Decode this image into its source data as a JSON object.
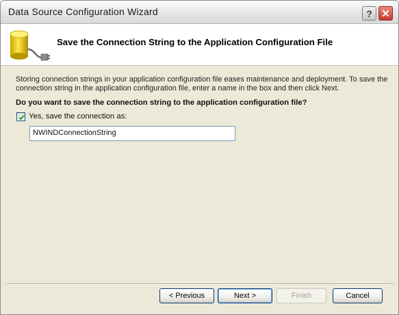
{
  "window": {
    "title": "Data Source Configuration Wizard",
    "help_label": "?",
    "close_label": "✕"
  },
  "header": {
    "title": "Save the Connection String to the Application Configuration File",
    "icon": "database-plug-icon"
  },
  "body": {
    "description": "Storing connection strings in your application configuration file eases maintenance and deployment. To save the connection string in the application configuration file, enter a name in the box and then click Next.",
    "question": "Do you want to save the connection string to the application configuration file?",
    "checkbox_label": "Yes, save the connection as:",
    "checkbox_checked": true,
    "connection_name": "NWINDConnectionString"
  },
  "buttons": {
    "previous": "< Previous",
    "next": "Next >",
    "finish": "Finish",
    "cancel": "Cancel"
  },
  "colors": {
    "accent_border": "#003c74",
    "close_button": "#c6382a"
  }
}
